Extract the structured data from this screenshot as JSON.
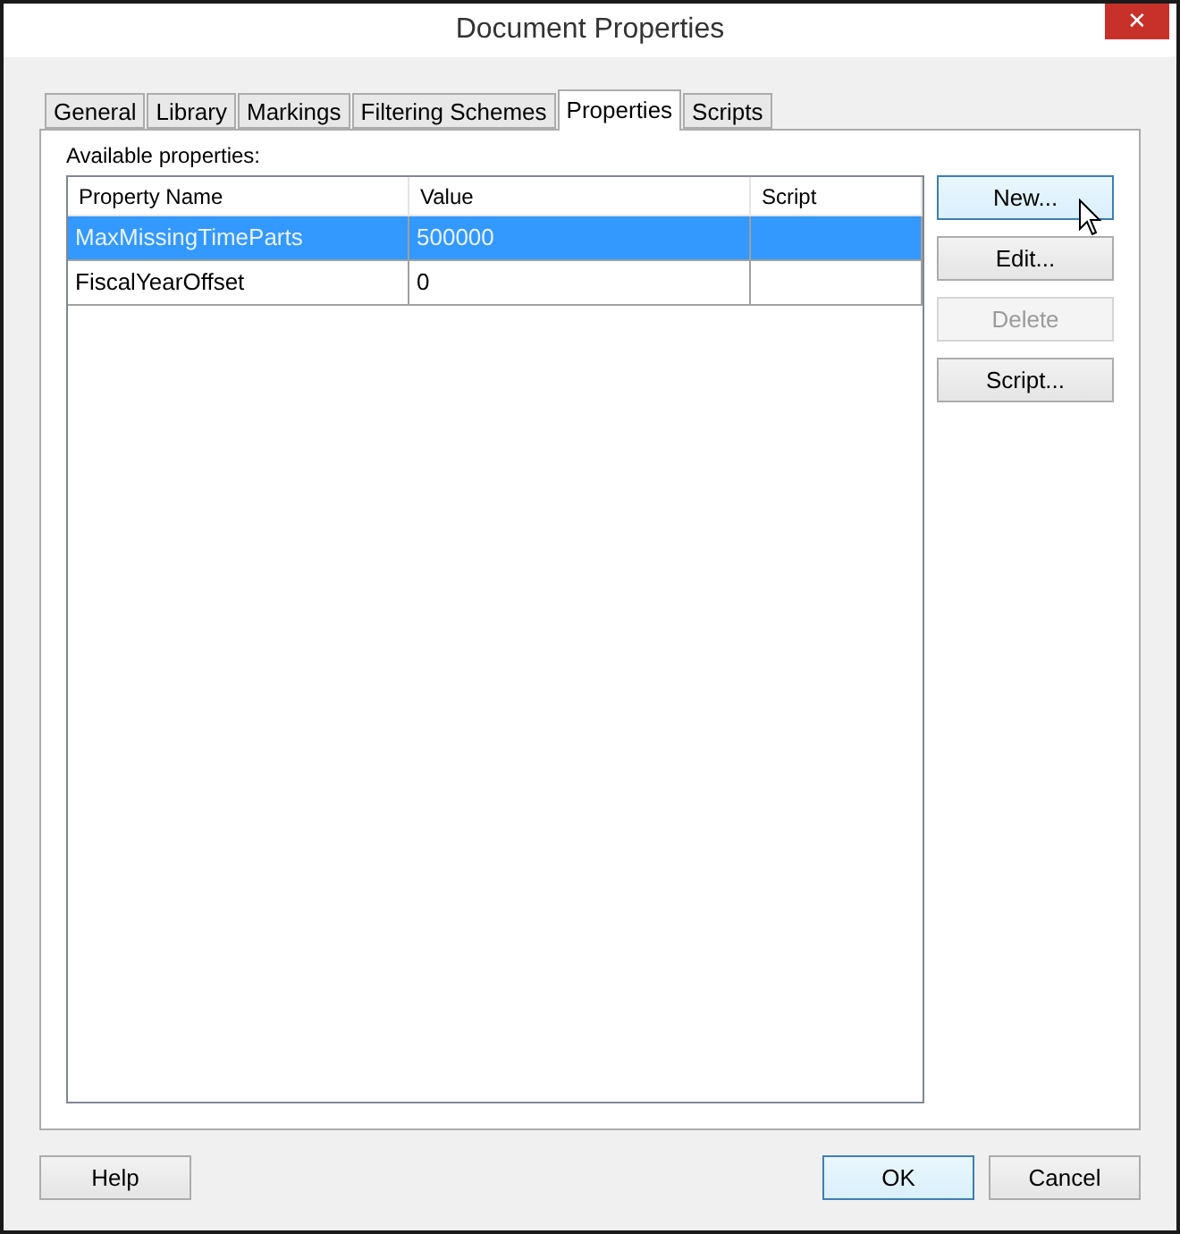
{
  "window": {
    "title": "Document Properties",
    "close": "✕"
  },
  "tabs": [
    {
      "label": "General",
      "selected": false
    },
    {
      "label": "Library",
      "selected": false
    },
    {
      "label": "Markings",
      "selected": false
    },
    {
      "label": "Filtering Schemes",
      "selected": false
    },
    {
      "label": "Properties",
      "selected": true
    },
    {
      "label": "Scripts",
      "selected": false
    }
  ],
  "list_label": "Available properties:",
  "table": {
    "columns": [
      "Property Name",
      "Value",
      "Script"
    ],
    "rows": [
      {
        "cells": [
          "MaxMissingTimeParts",
          "500000",
          ""
        ],
        "selected": true
      },
      {
        "cells": [
          "FiscalYearOffset",
          "0",
          ""
        ],
        "selected": false
      }
    ]
  },
  "side_buttons": [
    {
      "label": "New...",
      "disabled": false,
      "highlighted": true
    },
    {
      "label": "Edit...",
      "disabled": false,
      "highlighted": false
    },
    {
      "label": "Delete",
      "disabled": true,
      "highlighted": false
    },
    {
      "label": "Script...",
      "disabled": false,
      "highlighted": false
    }
  ],
  "footer_buttons": [
    {
      "label": "Help",
      "highlighted": false
    },
    {
      "label": "OK",
      "highlighted": true
    },
    {
      "label": "Cancel",
      "highlighted": false
    }
  ]
}
